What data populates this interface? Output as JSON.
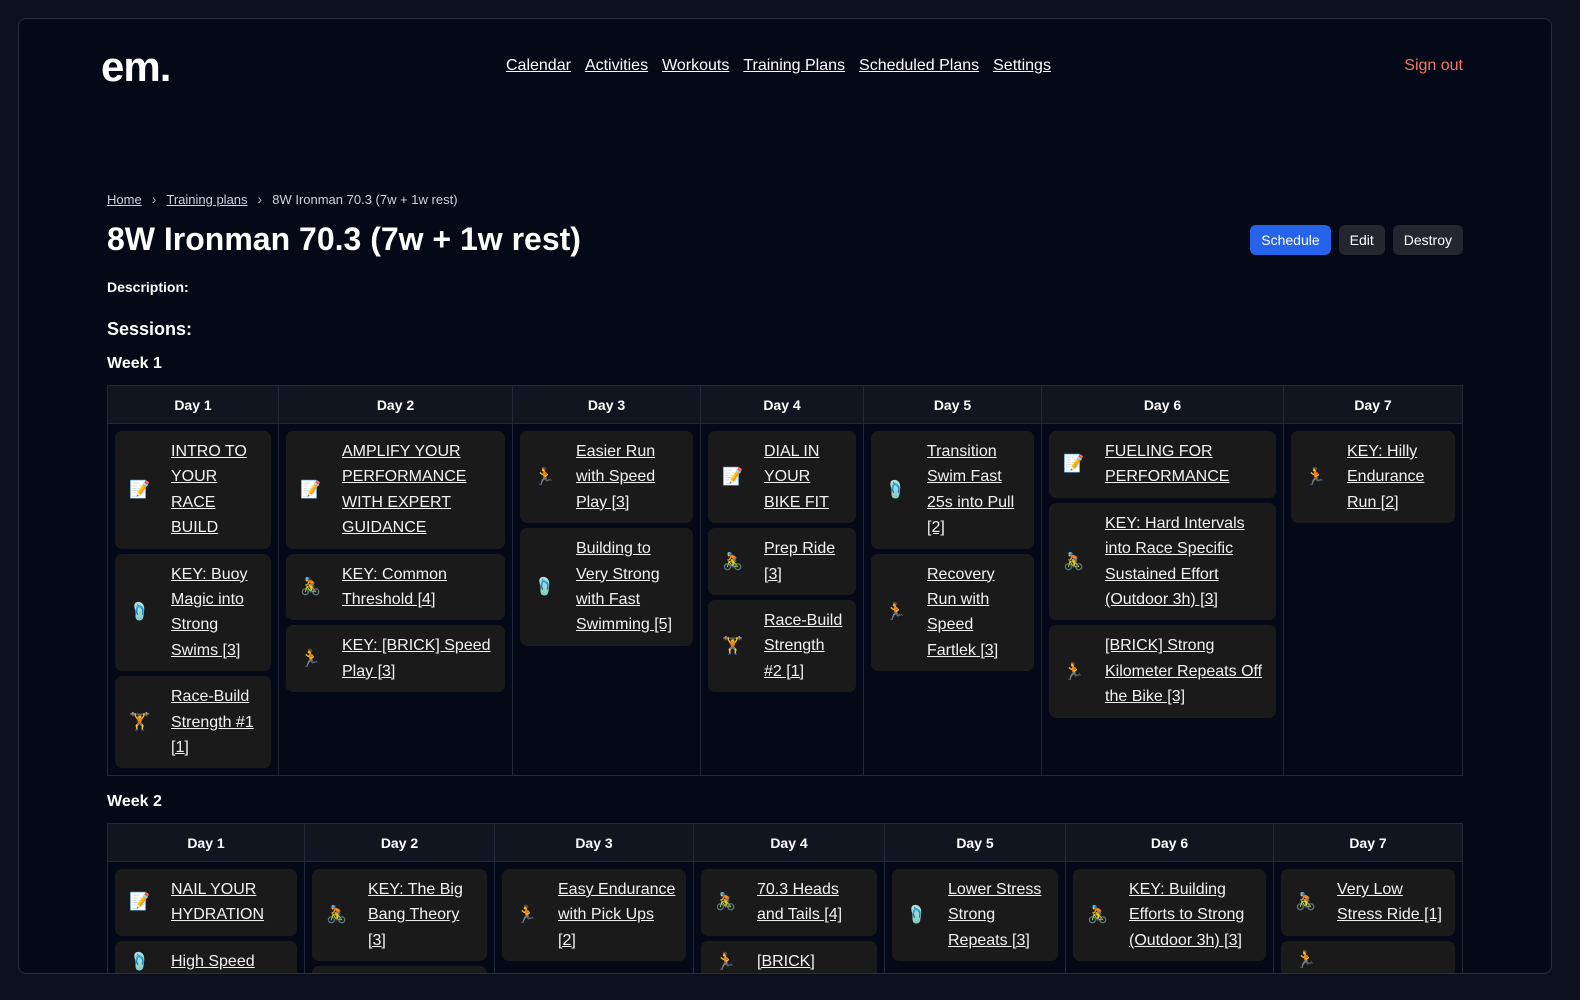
{
  "nav": {
    "logo": "em.",
    "links": [
      "Calendar",
      "Activities",
      "Workouts",
      "Training Plans",
      "Scheduled Plans",
      "Settings"
    ],
    "signout": "Sign out"
  },
  "breadcrumb": [
    "Home",
    "Training plans",
    "8W Ironman 70.3 (7w + 1w rest)"
  ],
  "title": "8W Ironman 70.3 (7w + 1w rest)",
  "actions": {
    "schedule": "Schedule",
    "edit": "Edit",
    "destroy": "Destroy"
  },
  "description_label": "Description:",
  "sessions_label": "Sessions:",
  "weeks": [
    {
      "label": "Week 1",
      "days": [
        {
          "label": "Day 1",
          "sessions": [
            {
              "icon": "note-icon",
              "title": "INTRO TO YOUR RACE BUILD"
            },
            {
              "icon": "swim-icon",
              "title": "KEY: Buoy Magic into Strong Swims [3]"
            },
            {
              "icon": "strength-icon",
              "title": "Race-Build Strength #1 [1]"
            }
          ]
        },
        {
          "label": "Day 2",
          "sessions": [
            {
              "icon": "note-icon",
              "title": "AMPLIFY YOUR PERFORMANCE WITH EXPERT GUIDANCE"
            },
            {
              "icon": "bike-icon",
              "title": "KEY: Common Threshold [4]"
            },
            {
              "icon": "run-icon",
              "title": "KEY: [BRICK] Speed Play [3]"
            }
          ]
        },
        {
          "label": "Day 3",
          "sessions": [
            {
              "icon": "run-icon",
              "title": "Easier Run with Speed Play [3]"
            },
            {
              "icon": "swim-icon",
              "title": "Building to Very Strong with Fast Swimming [5]"
            }
          ]
        },
        {
          "label": "Day 4",
          "sessions": [
            {
              "icon": "note-icon",
              "title": "DIAL IN YOUR BIKE FIT"
            },
            {
              "icon": "bike-icon",
              "title": "Prep Ride [3]"
            },
            {
              "icon": "strength-icon",
              "title": "Race-Build Strength #2 [1]"
            }
          ]
        },
        {
          "label": "Day 5",
          "sessions": [
            {
              "icon": "swim-icon",
              "title": "Transition Swim Fast 25s into Pull [2]"
            },
            {
              "icon": "run-icon",
              "title": "Recovery Run with Speed Fartlek [3]"
            }
          ]
        },
        {
          "label": "Day 6",
          "sessions": [
            {
              "icon": "note-icon",
              "title": "FUELING FOR PERFORMANCE"
            },
            {
              "icon": "bike-icon",
              "title": "KEY: Hard Intervals into Race Specific Sustained Effort (Outdoor 3h) [3]"
            },
            {
              "icon": "run-icon",
              "title": "[BRICK] Strong Kilometer Repeats Off the Bike [3]"
            }
          ]
        },
        {
          "label": "Day 7",
          "sessions": [
            {
              "icon": "run-icon",
              "title": "KEY: Hilly Endurance Run [2]"
            }
          ]
        }
      ]
    },
    {
      "label": "Week 2",
      "days": [
        {
          "label": "Day 1",
          "sessions": [
            {
              "icon": "note-icon",
              "title": "NAIL YOUR HYDRATION"
            },
            {
              "icon": "swim-icon",
              "title": "High Speed"
            }
          ]
        },
        {
          "label": "Day 2",
          "sessions": [
            {
              "icon": "bike-icon",
              "title": "KEY: The Big Bang Theory [3]"
            },
            {
              "icon": "run-icon",
              "title": ""
            }
          ]
        },
        {
          "label": "Day 3",
          "sessions": [
            {
              "icon": "run-icon",
              "title": "Easy Endurance with Pick Ups [2]"
            }
          ]
        },
        {
          "label": "Day 4",
          "sessions": [
            {
              "icon": "bike-icon",
              "title": "70.3 Heads and Tails [4]"
            },
            {
              "icon": "run-icon",
              "title": "[BRICK]"
            }
          ]
        },
        {
          "label": "Day 5",
          "sessions": [
            {
              "icon": "swim-icon",
              "title": "Lower Stress Strong Repeats [3]"
            }
          ]
        },
        {
          "label": "Day 6",
          "sessions": [
            {
              "icon": "bike-icon",
              "title": "KEY: Building Efforts to Strong (Outdoor 3h) [3]"
            }
          ]
        },
        {
          "label": "Day 7",
          "sessions": [
            {
              "icon": "bike-icon",
              "title": "Very Low Stress Ride [1]"
            },
            {
              "icon": "run-icon",
              "title": ""
            }
          ]
        }
      ]
    }
  ],
  "icon_glyphs": {
    "note-icon": "📝",
    "swim-icon": "🩴",
    "bike-icon": "🚴",
    "run-icon": "🏃",
    "strength-icon": "🏋"
  }
}
